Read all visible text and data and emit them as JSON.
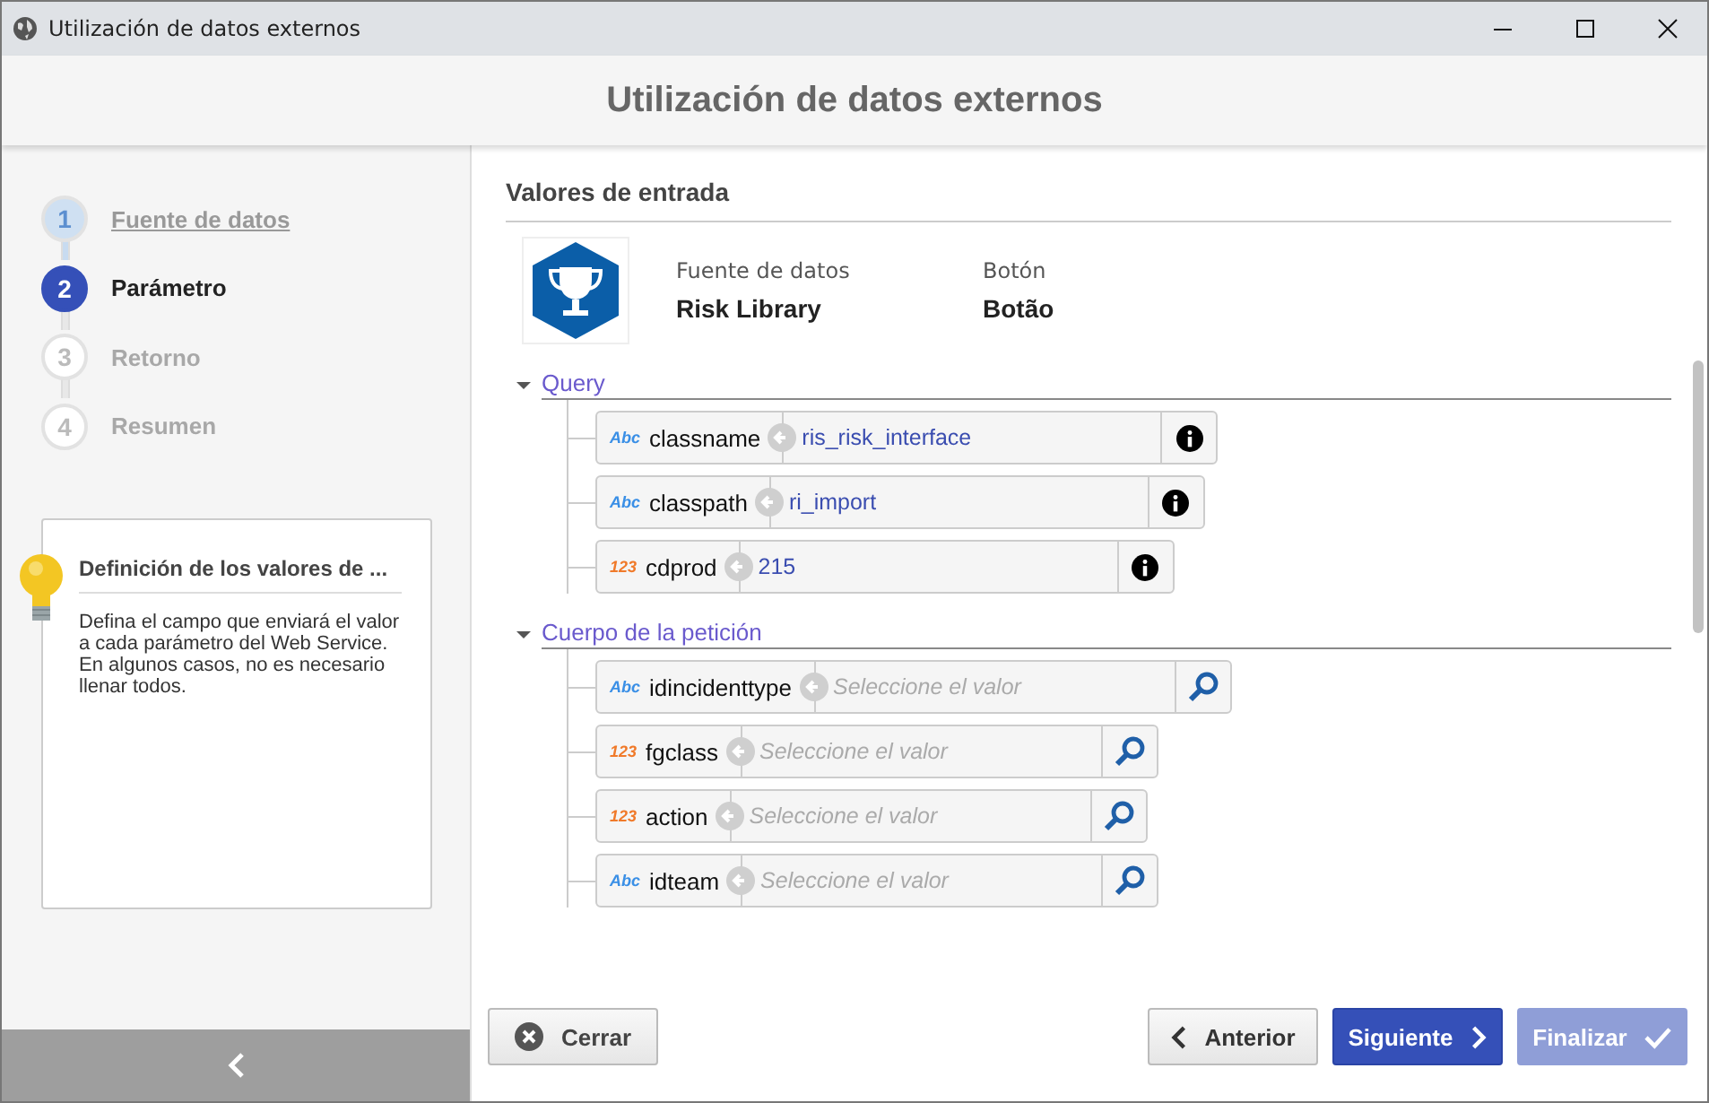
{
  "window": {
    "title": "Utilización de datos externos"
  },
  "header": {
    "title": "Utilización de datos externos"
  },
  "steps": [
    {
      "number": "1",
      "label": "Fuente de datos",
      "completed": true,
      "selected": false
    },
    {
      "number": "2",
      "label": "Parámetro",
      "completed": false,
      "selected": true
    },
    {
      "number": "3",
      "label": "Retorno",
      "completed": false,
      "selected": false
    },
    {
      "number": "4",
      "label": "Resumen",
      "completed": false,
      "selected": false
    }
  ],
  "help": {
    "title": "Definición de los valores de ...",
    "text": "Defina el campo que enviará el valor a cada parámetro del Web Service. En algunos casos, no es necesario llenar todos."
  },
  "section": {
    "title": "Valores de entrada"
  },
  "source": {
    "fields": [
      {
        "label": "Fuente de datos",
        "value": "Risk Library"
      },
      {
        "label": "Botón",
        "value": "Botão"
      }
    ]
  },
  "groups": [
    {
      "title": "Query",
      "expanded": true,
      "params": [
        {
          "type_label": "Abc",
          "color": "#3a8fe6",
          "name": "classname",
          "value": "ris_risk_interface",
          "searchable": false
        },
        {
          "type_label": "Abc",
          "color": "#3a8fe6",
          "name": "classpath",
          "value": "ri_import",
          "searchable": false
        },
        {
          "type_label": "123",
          "color": "#f07a2a",
          "name": "cdprod",
          "value": "215",
          "searchable": false
        }
      ]
    },
    {
      "title": "Cuerpo de la petición",
      "expanded": true,
      "params": [
        {
          "type_label": "Abc",
          "color": "#3a8fe6",
          "name": "idincidenttype",
          "placeholder": "Seleccione el valor",
          "searchable": true
        },
        {
          "type_label": "123",
          "color": "#f07a2a",
          "name": "fgclass",
          "placeholder": "Seleccione el valor",
          "searchable": true
        },
        {
          "type_label": "123",
          "color": "#f07a2a",
          "name": "action",
          "placeholder": "Seleccione el valor",
          "searchable": true
        },
        {
          "type_label": "Abc",
          "color": "#3a8fe6",
          "name": "idteam",
          "placeholder": "Seleccione el valor",
          "searchable": true
        }
      ]
    }
  ],
  "buttons": [
    {
      "label": "Cerrar",
      "kind": "close",
      "disabled": false
    },
    {
      "label": "Anterior",
      "kind": "back",
      "disabled": false
    },
    {
      "label": "Siguiente",
      "kind": "next",
      "disabled": false
    },
    {
      "label": "Finalizar",
      "kind": "finish",
      "disabled": true
    }
  ]
}
